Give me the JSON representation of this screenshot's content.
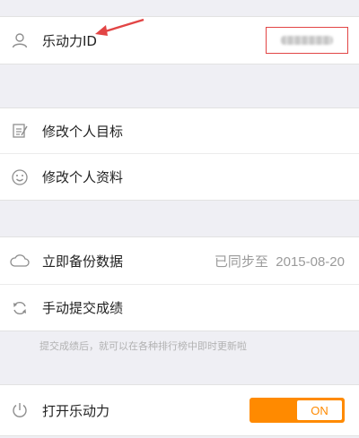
{
  "account": {
    "id_label": "乐动力ID",
    "id_value": ""
  },
  "settings": {
    "items": [
      {
        "label": "修改个人目标",
        "icon": "edit-icon"
      },
      {
        "label": "修改个人资料",
        "icon": "smile-icon"
      }
    ]
  },
  "sync": {
    "backup_label": "立即备份数据",
    "backup_status": "已同步至  2015-08-20",
    "submit_label": "手动提交成绩",
    "hint": "提交成绩后，就可以在各种排行榜中即时更新啦"
  },
  "power": {
    "label": "打开乐动力",
    "toggle": "ON",
    "accent": "#ff8a00"
  }
}
